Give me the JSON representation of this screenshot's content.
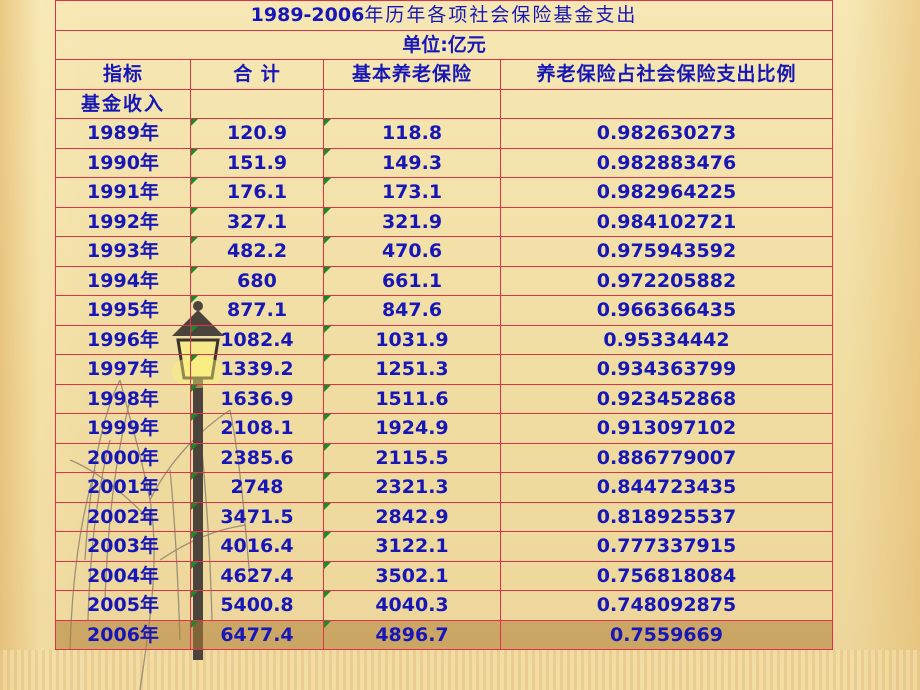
{
  "title_num": "1989-2006",
  "title_text": "年历年各项社会保险基金支出",
  "unit": "单位:亿元",
  "headers": [
    "指标",
    "合  计",
    "基本养老保险",
    "养老保险占社会保险支出比例"
  ],
  "subheader": "基金收入",
  "rows": [
    [
      "1989年",
      "120.9",
      "118.8",
      "0.982630273"
    ],
    [
      "1990年",
      "151.9",
      "149.3",
      "0.982883476"
    ],
    [
      "1991年",
      "176.1",
      "173.1",
      "0.982964225"
    ],
    [
      "1992年",
      "327.1",
      "321.9",
      "0.984102721"
    ],
    [
      "1993年",
      "482.2",
      "470.6",
      "0.975943592"
    ],
    [
      "1994年",
      "680",
      "661.1",
      "0.972205882"
    ],
    [
      "1995年",
      "877.1",
      "847.6",
      "0.966366435"
    ],
    [
      "1996年",
      "1082.4",
      "1031.9",
      "0.95334442"
    ],
    [
      "1997年",
      "1339.2",
      "1251.3",
      "0.934363799"
    ],
    [
      "1998年",
      "1636.9",
      "1511.6",
      "0.923452868"
    ],
    [
      "1999年",
      "2108.1",
      "1924.9",
      "0.913097102"
    ],
    [
      "2000年",
      "2385.6",
      "2115.5",
      "0.886779007"
    ],
    [
      "2001年",
      "2748",
      "2321.3",
      "0.844723435"
    ],
    [
      "2002年",
      "3471.5",
      "2842.9",
      "0.818925537"
    ],
    [
      "2003年",
      "4016.4",
      "3122.1",
      "0.777337915"
    ],
    [
      "2004年",
      "4627.4",
      "3502.1",
      "0.756818084"
    ],
    [
      "2005年",
      "5400.8",
      "4040.3",
      "0.748092875"
    ],
    [
      "2006年",
      "6477.4",
      "4896.7",
      "0.7559669"
    ]
  ],
  "colors": {
    "text": "#1717b8",
    "grid": "#e0304a",
    "highlight_row": "#b07d37"
  },
  "background_icons": [
    "willow-tree-icon",
    "street-lamp-icon"
  ]
}
